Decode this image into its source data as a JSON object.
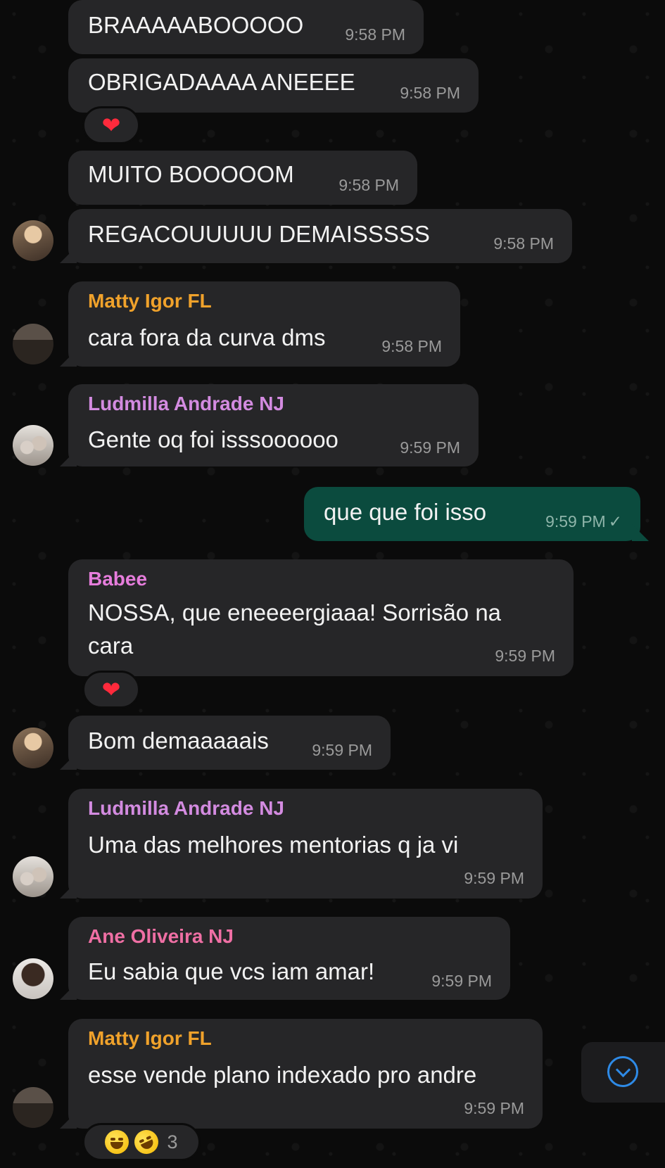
{
  "colors": {
    "incoming_bubble": "#262628",
    "outgoing_bubble": "#0b4b3e",
    "sender_matty": "#f0a22b",
    "sender_ludmilla": "#d38be0",
    "sender_babee": "#e67ddc",
    "sender_ane": "#ef6fa4",
    "scroll_button_accent": "#2e8ae6"
  },
  "messages": [
    {
      "text": "BRAAAAABOOOOO",
      "time": "9:58 PM"
    },
    {
      "text": "OBRIGADAAAA ANEEEE",
      "time": "9:58 PM",
      "reaction": "heart"
    },
    {
      "text": "MUITO BOOOOOM",
      "time": "9:58 PM"
    },
    {
      "text": "REGACOUUUUU DEMAISSSSS",
      "time": "9:58 PM"
    },
    {
      "sender": "Matty Igor FL",
      "text": "cara fora da curva dms",
      "time": "9:58 PM"
    },
    {
      "sender": "Ludmilla Andrade NJ",
      "text": "Gente oq foi isssoooooo",
      "time": "9:59 PM"
    },
    {
      "text": "que que foi isso",
      "time": "9:59 PM",
      "outgoing": true,
      "status": "sent-check"
    },
    {
      "sender": "Babee",
      "text": "NOSSA, que eneeeergiaaa! Sorrisão na\ncara",
      "time": "9:59 PM",
      "reaction": "heart"
    },
    {
      "text": "Bom demaaaaais",
      "time": "9:59 PM"
    },
    {
      "sender": "Ludmilla Andrade NJ",
      "text": "Uma das melhores mentorias q ja vi",
      "time": "9:59 PM"
    },
    {
      "sender": "Ane Oliveira NJ",
      "text": "Eu sabia que vcs iam amar!",
      "time": "9:59 PM"
    },
    {
      "sender": "Matty Igor FL",
      "text": "esse vende plano indexado pro andre",
      "time": "9:59 PM",
      "reactions": {
        "emojis": [
          "joy-face",
          "rofl-face"
        ],
        "count": "3"
      }
    }
  ],
  "icons": {
    "heart": "red-heart-icon",
    "check": "single-check-icon",
    "scroll": "chevron-down-circle-icon"
  },
  "glyphs": {
    "heart": "❤",
    "check": "✓"
  }
}
